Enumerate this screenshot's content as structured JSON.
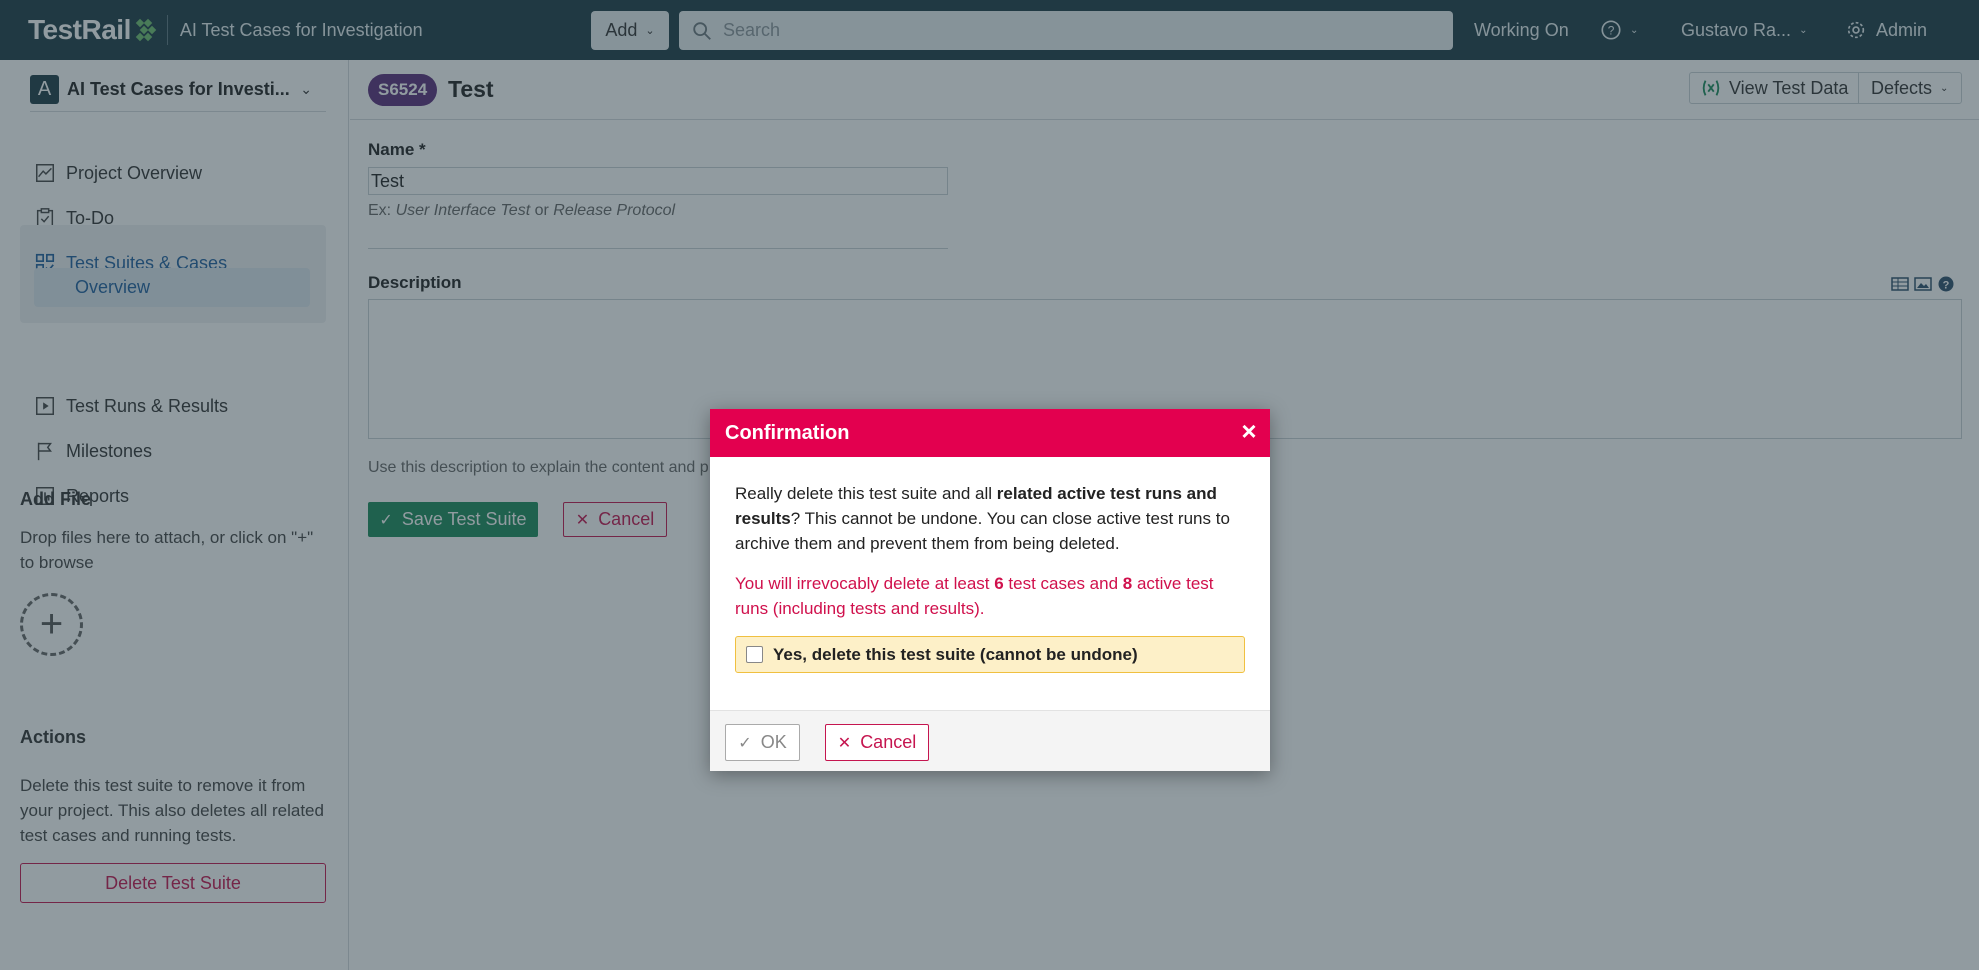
{
  "topbar": {
    "brand": "TestRail",
    "project": "AI Test Cases for Investigation",
    "add_label": "Add",
    "search_placeholder": "Search",
    "working_on": "Working On",
    "user": "Gustavo Ra...",
    "admin": "Admin"
  },
  "sidebar": {
    "project_avatar": "A",
    "project_name": "AI Test Cases for Investi...",
    "items": [
      {
        "label": "Project Overview",
        "icon": "chart-icon"
      },
      {
        "label": "To-Do",
        "icon": "clipboard-check-icon"
      },
      {
        "label": "Test Suites & Cases",
        "icon": "grid-check-icon"
      },
      {
        "label": "Overview"
      },
      {
        "label": "Test Runs & Results",
        "icon": "play-icon"
      },
      {
        "label": "Milestones",
        "icon": "flag-icon"
      },
      {
        "label": "Reports",
        "icon": "bar-chart-icon"
      }
    ],
    "add_file_title": "Add File",
    "add_file_text": "Drop files here to attach, or click on \"+\" to browse",
    "actions_title": "Actions",
    "actions_text": "Delete this test suite to remove it from your project. This also deletes all related test cases and running tests.",
    "delete_label": "Delete Test Suite"
  },
  "main": {
    "badge": "S6524",
    "title": "Test",
    "view_test_data": "View Test Data",
    "defects": "Defects",
    "name_label": "Name *",
    "name_value": "Test",
    "name_hint_prefix": "Ex: ",
    "name_hint_a": "User Interface Test",
    "name_hint_or": " or ",
    "name_hint_b": "Release Protocol",
    "description_label": "Description",
    "description_hint": "Use this description to explain the content and p",
    "save_label": "Save Test Suite",
    "cancel_label": "Cancel"
  },
  "dialog": {
    "title": "Confirmation",
    "body_1": "Really delete this test suite and all ",
    "body_bold": "related active test runs and results",
    "body_2": "? This cannot be undone. You can close active test runs to archive them and prevent them from being deleted.",
    "warn_1": "You will irrevocably delete at least ",
    "warn_cases": "6",
    "warn_2": " test cases and ",
    "warn_runs": "8",
    "warn_3": " active test runs (including tests and results).",
    "confirm_label": "Yes, delete this test suite (cannot be undone)",
    "ok_label": "OK",
    "cancel_label": "Cancel"
  },
  "colors": {
    "topbar": "#1d3a45",
    "dialog_header": "#e3004f",
    "save_button": "#1a8a5a",
    "badge": "#5b2d7a",
    "danger": "#c5154f"
  }
}
